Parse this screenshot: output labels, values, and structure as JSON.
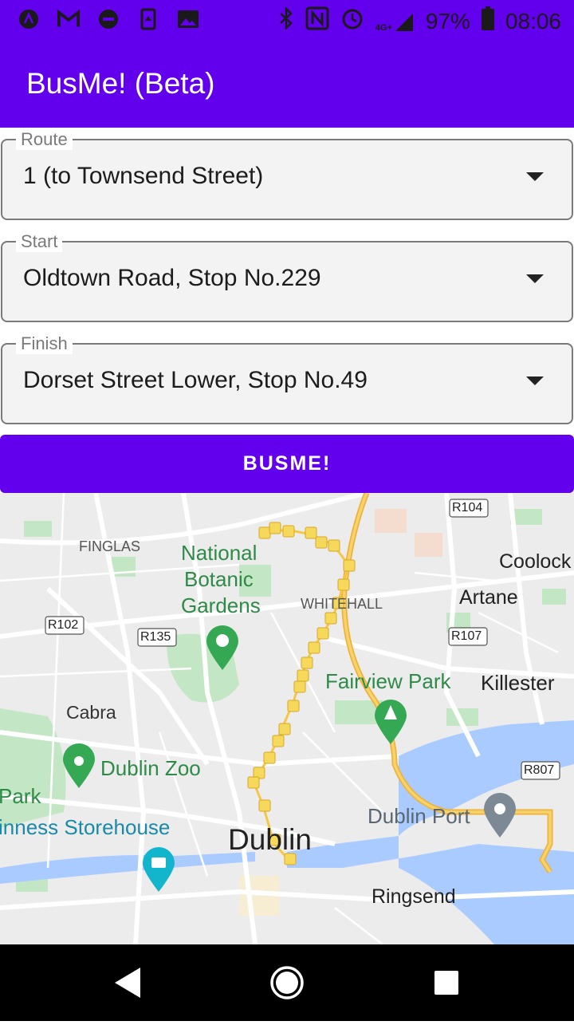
{
  "status_bar": {
    "battery": "97%",
    "time": "08:06",
    "network": "4G+"
  },
  "app_bar": {
    "title": "BusMe! (Beta)"
  },
  "form": {
    "route": {
      "label": "Route",
      "value": "1 (to Townsend Street)"
    },
    "start": {
      "label": "Start",
      "value": "Oldtown Road, Stop No.229"
    },
    "finish": {
      "label": "Finish",
      "value": "Dorset Street Lower, Stop No.49"
    },
    "submit_label": "BUSME!"
  },
  "map": {
    "places": {
      "finglas": "FINGLAS",
      "botanic_1": "National",
      "botanic_2": "Botanic",
      "botanic_3": "Gardens",
      "whitehall": "WHITEHALL",
      "coolock": "Coolock",
      "artane": "Artane",
      "fairview": "Fairview Park",
      "killester": "Killester",
      "cabra": "Cabra",
      "dublin_zoo": "Dublin Zoo",
      "park": "Park",
      "guinness": "inness Storehouse",
      "dublin": "Dublin",
      "dublin_port": "Dublin Port",
      "ringsend": "Ringsend"
    },
    "road_labels": {
      "r104": "R104",
      "r102": "R102",
      "r135": "R135",
      "r107": "R107",
      "r807": "R807"
    },
    "colors": {
      "route_line": "#f6c744",
      "park_green": "#c3e6c5",
      "water": "#aacbff",
      "accent": "#6200ee"
    }
  }
}
